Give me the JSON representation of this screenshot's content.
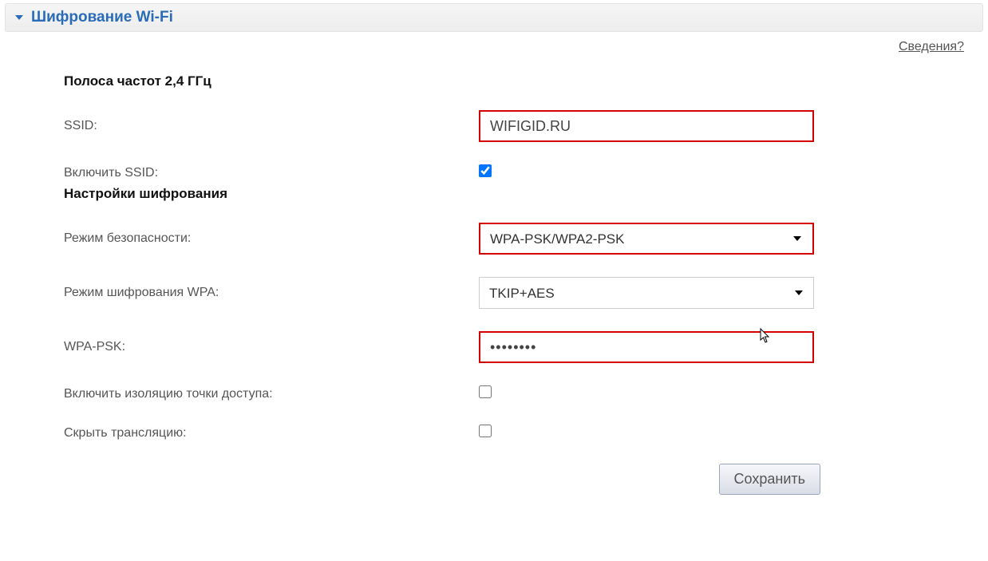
{
  "panel": {
    "title": "Шифрование Wi-Fi"
  },
  "help_link": "Сведения?",
  "section1_heading": "Полоса частот 2,4 ГГц",
  "section2_heading": "Настройки шифрования",
  "labels": {
    "ssid": "SSID:",
    "enable_ssid": "Включить SSID:",
    "security_mode": "Режим безопасности:",
    "wpa_cipher_mode": "Режим шифрования WPA:",
    "wpa_psk": "WPA-PSK:",
    "enable_isolation": "Включить изоляцию точки доступа:",
    "hide_broadcast": "Скрыть трансляцию:"
  },
  "values": {
    "ssid": "WIFIGID.RU",
    "enable_ssid_checked": true,
    "security_mode": "WPA-PSK/WPA2-PSK",
    "wpa_cipher_mode": "TKIP+AES",
    "wpa_psk": "••••••••",
    "enable_isolation_checked": false,
    "hide_broadcast_checked": false
  },
  "buttons": {
    "save": "Сохранить"
  }
}
